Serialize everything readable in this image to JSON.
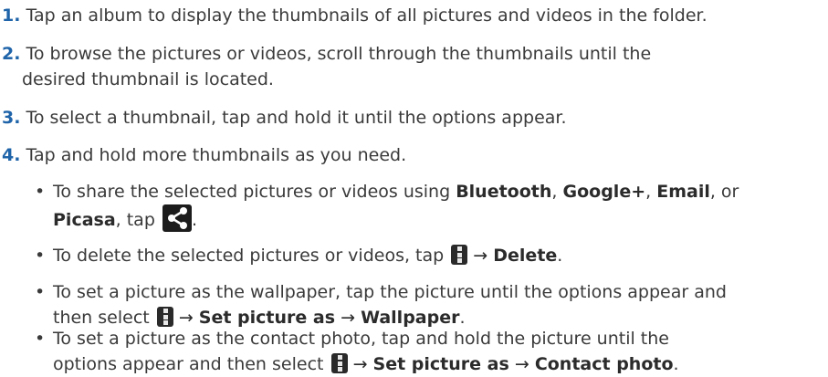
{
  "steps": [
    {
      "num": "1.",
      "text": "Tap an album to display the thumbnails of all pictures and videos in the folder."
    },
    {
      "num": "2.",
      "line1": "To browse the pictures or videos, scroll through the thumbnails until the",
      "line2": "desired thumbnail is located."
    },
    {
      "num": "3.",
      "text": "To select a thumbnail, tap and hold it until the options appear."
    },
    {
      "num": "4.",
      "text": "Tap and hold more thumbnails as you need."
    }
  ],
  "bullets": {
    "share": {
      "t1": "To share the selected pictures or videos using ",
      "b1": "Bluetooth",
      "c1": ", ",
      "b2": "Google+",
      "c2": ", ",
      "b3": "Email",
      "c3": ", or",
      "b4": "Picasa",
      "t2": ", tap ",
      "t3": "."
    },
    "delete": {
      "t1": "To delete the selected pictures or videos, tap ",
      "arrow": "→",
      "b1": "Delete",
      "t2": "."
    },
    "wallpaper": {
      "line1": "To set a picture as the wallpaper, tap the picture until the options appear and",
      "t1": "then select ",
      "arrow1": "→",
      "b1": "Set picture as",
      "arrow2": "→",
      "b2": "Wallpaper",
      "t2": "."
    },
    "contact": {
      "line1": "To set a picture as the contact photo, tap and hold the picture until the",
      "t1": "options appear and then select ",
      "arrow1": "→",
      "b1": "Set picture as",
      "arrow2": "→",
      "b2": "Contact photo",
      "t2": "."
    },
    "dot": "•"
  },
  "icons": {
    "share": "share-icon",
    "menu": "overflow-menu-icon"
  },
  "colors": {
    "step_number": "#1f64a9",
    "text": "#3a3a3a",
    "icon_bg": "#2a2a2a"
  }
}
